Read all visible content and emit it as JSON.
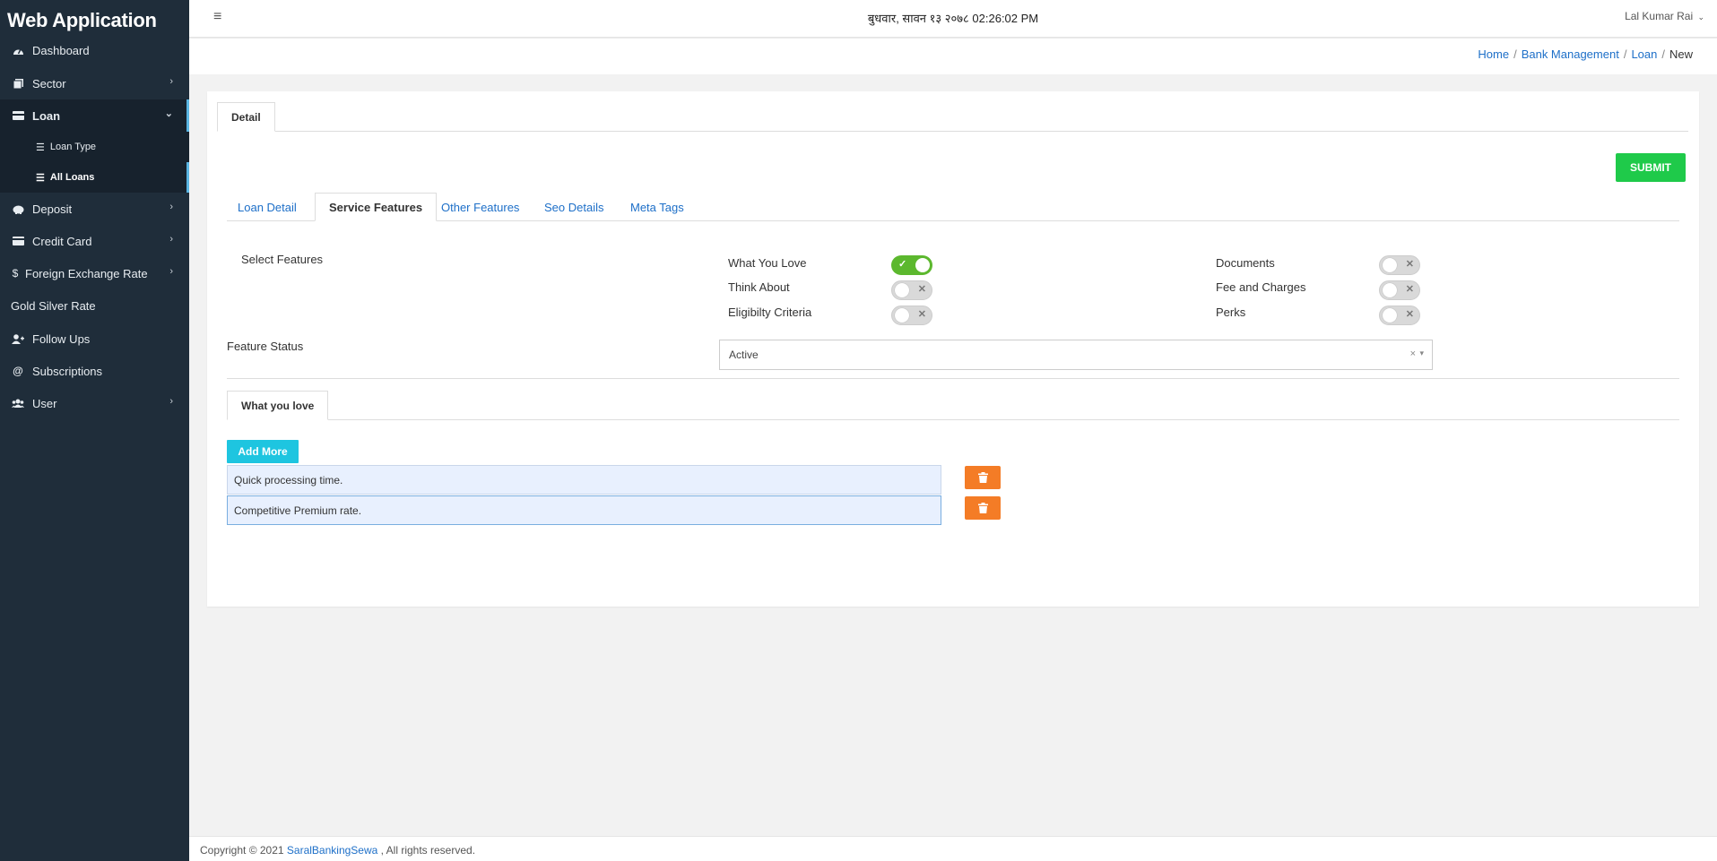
{
  "sidebar": {
    "brand": "Web Application",
    "items": [
      {
        "label": "Dashboard",
        "icon": "dashboard-icon"
      },
      {
        "label": "Sector",
        "icon": "sector-icon"
      },
      {
        "label": "Loan",
        "icon": "loan-icon"
      },
      {
        "label": "Deposit",
        "icon": "deposit-icon"
      },
      {
        "label": "Credit Card",
        "icon": "credit-card-icon"
      },
      {
        "label": "Foreign Exchange Rate",
        "icon": "dollar-icon"
      },
      {
        "label": "Gold Silver Rate"
      },
      {
        "label": "Follow Ups",
        "icon": "user-plus-icon"
      },
      {
        "label": "Subscriptions",
        "icon": "at-icon"
      },
      {
        "label": "User",
        "icon": "users-icon"
      }
    ],
    "loan_sub": [
      {
        "label": "Loan Type",
        "icon": "list-icon"
      },
      {
        "label": "All Loans",
        "icon": "list-icon"
      }
    ]
  },
  "header": {
    "datetime": "बुधवार, सावन १३ २०७८  02:26:02 PM",
    "user": "Lal Kumar Rai"
  },
  "breadcrumb": {
    "home": "Home",
    "bank": "Bank Management",
    "loan": "Loan",
    "current": "New"
  },
  "card": {
    "top_tab": "Detail",
    "submit": "SUBMIT",
    "tabs": [
      "Loan Detail",
      "Service Features",
      "Other Features",
      "Seo Details",
      "Meta Tags"
    ],
    "active_tab": "Service Features",
    "select_features_label": "Select Features",
    "features": [
      {
        "label": "What You Love",
        "on": true
      },
      {
        "label": "Think About",
        "on": false
      },
      {
        "label": "Eligibilty Criteria",
        "on": false
      },
      {
        "label": "Documents",
        "on": false
      },
      {
        "label": "Fee and Charges",
        "on": false
      },
      {
        "label": "Perks",
        "on": false
      }
    ],
    "feature_status_label": "Feature Status",
    "feature_status_value": "Active",
    "section_tab": "What you love",
    "add_more": "Add More",
    "rows": [
      "Quick processing time.",
      "Competitive Premium rate."
    ]
  },
  "footer": {
    "prefix": "Copyright © 2021 ",
    "company": "SaralBankingSewa",
    "suffix": " , All rights reserved."
  },
  "colors": {
    "sidebar_bg": "#1f2d3a",
    "submit": "#1fca4a",
    "add_more": "#1ec5e0",
    "delete": "#f47c26",
    "toggle_on": "#5cb82e",
    "link": "#1d6fc8"
  }
}
